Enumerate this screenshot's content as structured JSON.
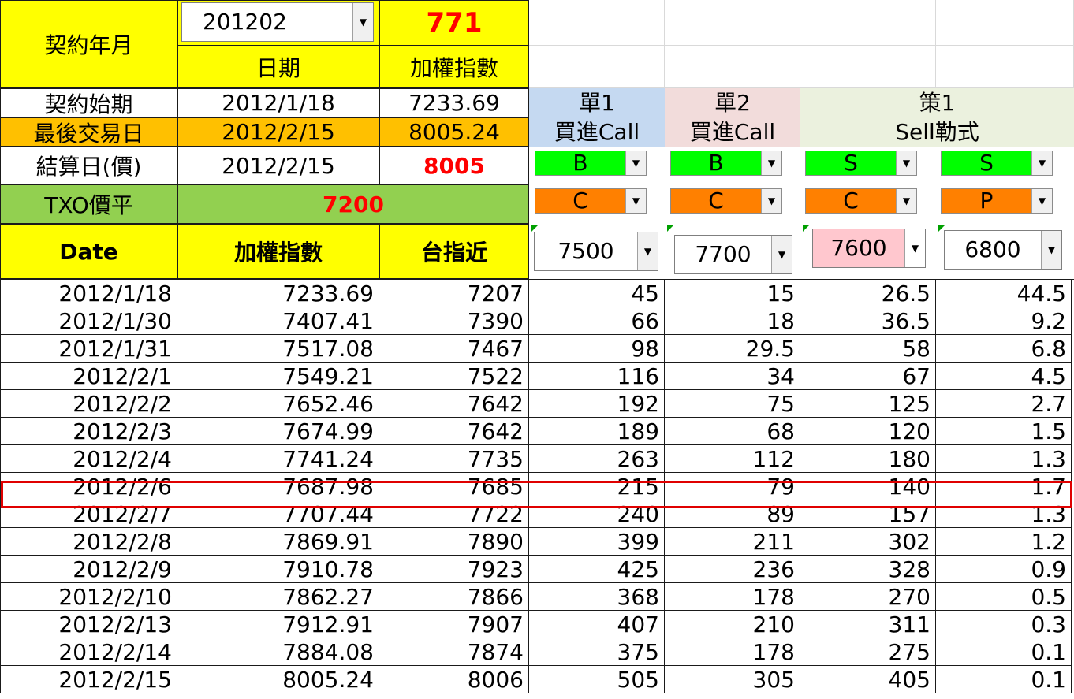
{
  "header": {
    "contract_label": "契約年月",
    "contract_value": "201202",
    "points_value": "771",
    "date_label": "日期",
    "index_label": "加權指數",
    "start_label": "契約始期",
    "start_date": "2012/1/18",
    "start_index": "7233.69",
    "last_trade_label": "最後交易日",
    "last_trade_date": "2012/2/15",
    "last_trade_index": "8005.24",
    "settle_label": "結算日(價)",
    "settle_date": "2012/2/15",
    "settle_price": "8005",
    "txo_label": "TXO價平",
    "txo_value": "7200"
  },
  "strategies": {
    "s1_line1": "單1",
    "s1_line2": "買進Call",
    "s2_line1": "單2",
    "s2_line2": "買進Call",
    "s3_line1": "策1",
    "s3_line2": "Sell勒式"
  },
  "selectors": {
    "side": [
      "B",
      "B",
      "S",
      "S"
    ],
    "type": [
      "C",
      "C",
      "C",
      "P"
    ],
    "strike": [
      "7500",
      "7700",
      "7600",
      "6800"
    ]
  },
  "table": {
    "headers": [
      "Date",
      "加權指數",
      "台指近"
    ],
    "rows": [
      [
        "2012/1/18",
        "7233.69",
        "7207",
        "45",
        "15",
        "26.5",
        "44.5"
      ],
      [
        "2012/1/30",
        "7407.41",
        "7390",
        "66",
        "18",
        "36.5",
        "9.2"
      ],
      [
        "2012/1/31",
        "7517.08",
        "7467",
        "98",
        "29.5",
        "58",
        "6.8"
      ],
      [
        "2012/2/1",
        "7549.21",
        "7522",
        "116",
        "34",
        "67",
        "4.5"
      ],
      [
        "2012/2/2",
        "7652.46",
        "7642",
        "192",
        "75",
        "125",
        "2.7"
      ],
      [
        "2012/2/3",
        "7674.99",
        "7642",
        "189",
        "68",
        "120",
        "1.5"
      ],
      [
        "2012/2/4",
        "7741.24",
        "7735",
        "263",
        "112",
        "180",
        "1.3"
      ],
      [
        "2012/2/6",
        "7687.98",
        "7685",
        "215",
        "79",
        "140",
        "1.7"
      ],
      [
        "2012/2/7",
        "7707.44",
        "7722",
        "240",
        "89",
        "157",
        "1.3"
      ],
      [
        "2012/2/8",
        "7869.91",
        "7890",
        "399",
        "211",
        "302",
        "1.2"
      ],
      [
        "2012/2/9",
        "7910.78",
        "7923",
        "425",
        "236",
        "328",
        "0.9"
      ],
      [
        "2012/2/10",
        "7862.27",
        "7866",
        "368",
        "178",
        "270",
        "0.5"
      ],
      [
        "2012/2/13",
        "7912.91",
        "7907",
        "407",
        "210",
        "311",
        "0.3"
      ],
      [
        "2012/2/14",
        "7884.08",
        "7874",
        "375",
        "178",
        "275",
        "0.1"
      ],
      [
        "2012/2/15",
        "8005.24",
        "8006",
        "505",
        "305",
        "405",
        "0.1"
      ]
    ]
  },
  "colors": {
    "header_yellow": "#ffff00",
    "last_trade_orange": "#ffc000",
    "txo_green": "#92d050",
    "buy_sell_green": "#00ff00",
    "call_put_orange": "#ff8000",
    "highlight_red": "#e00000",
    "accent_red_text": "#ff0000"
  },
  "icons": {
    "dropdown_arrow": "chevron-down-icon"
  },
  "highlighted_row_date": "2012/2/6"
}
